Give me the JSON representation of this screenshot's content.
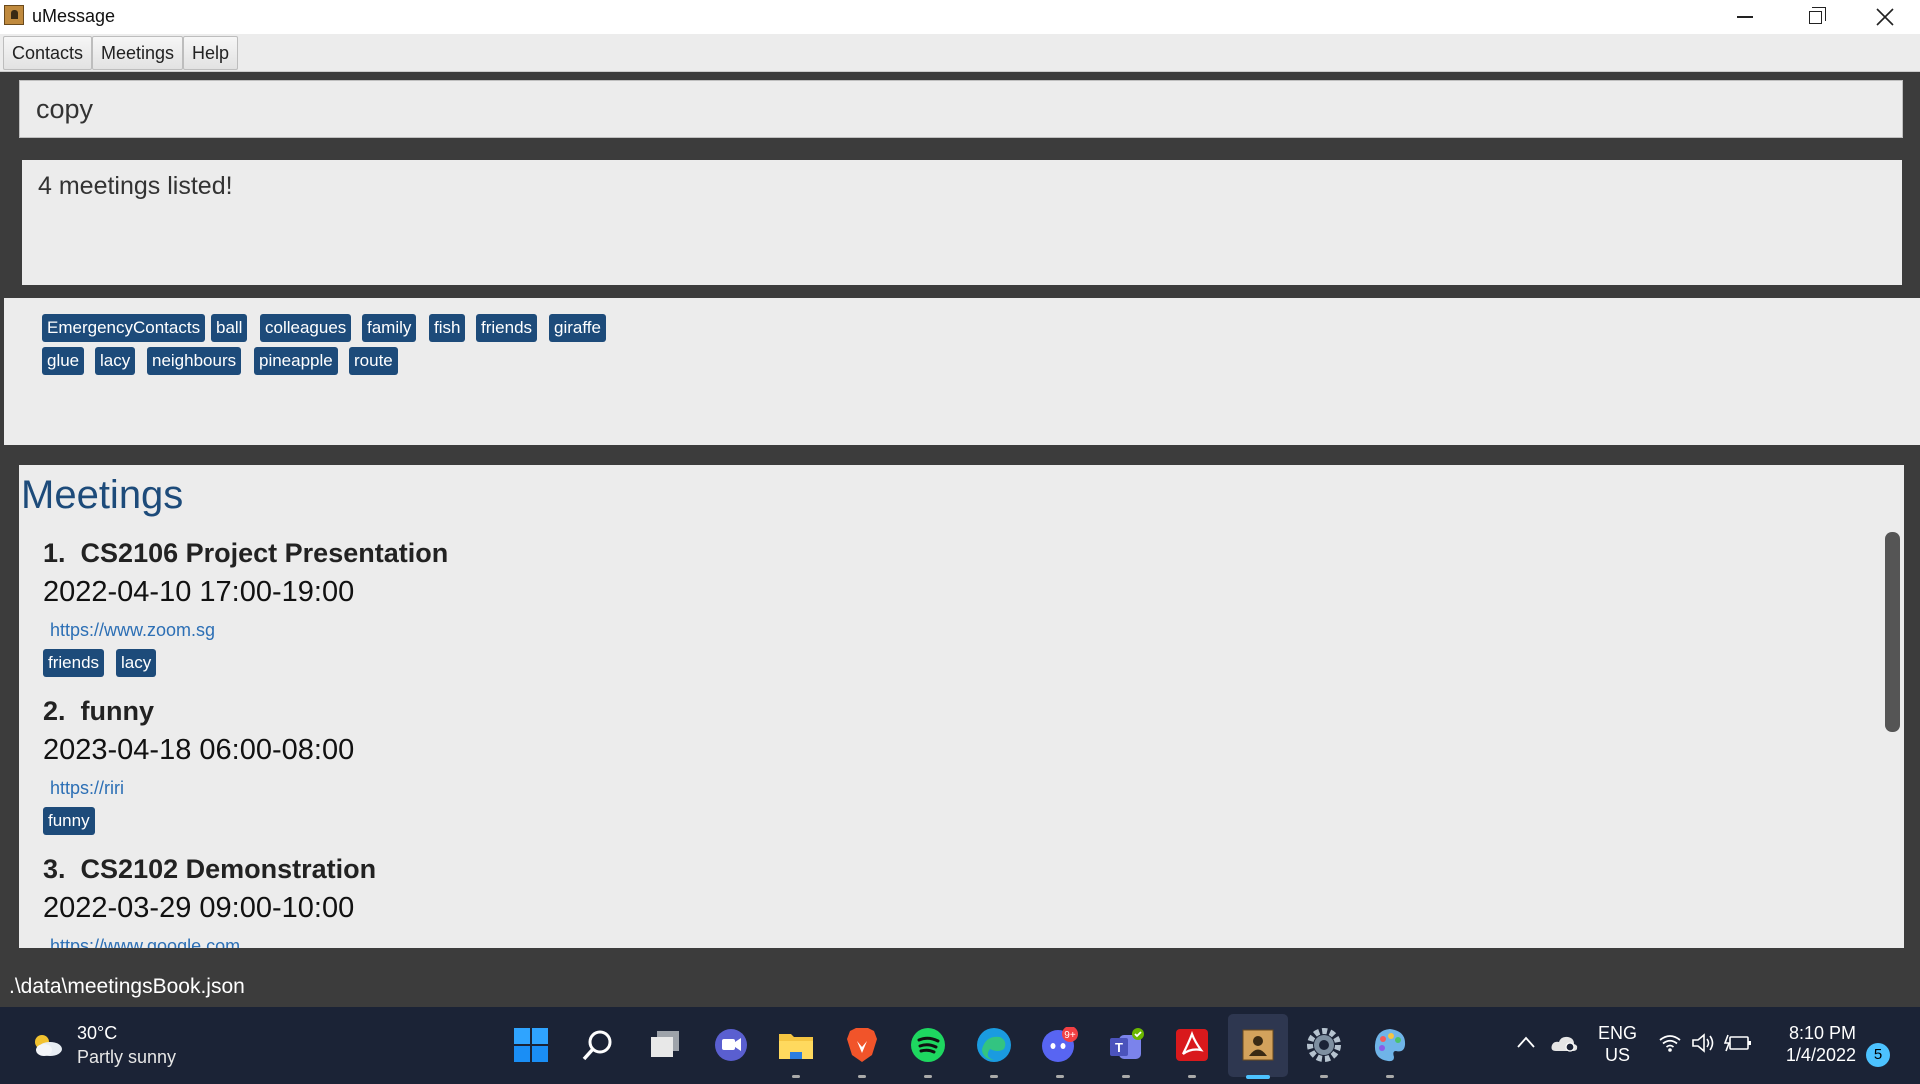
{
  "window": {
    "title": "uMessage",
    "controls": {
      "minimize": "minimize",
      "maximize": "restore",
      "close": "close"
    }
  },
  "menu": [
    {
      "label": "Contacts"
    },
    {
      "label": "Meetings"
    },
    {
      "label": "Help"
    }
  ],
  "command": {
    "value": "copy"
  },
  "result": {
    "text": "4 meetings listed!"
  },
  "tag_panel": {
    "rows": [
      [
        "EmergencyContacts",
        "ball",
        "colleagues",
        "family",
        "fish",
        "friends",
        "giraffe"
      ],
      [
        "glue",
        "lacy",
        "neighbours",
        "pineapple",
        "route"
      ]
    ]
  },
  "meetings_panel": {
    "title": "Meetings",
    "items": [
      {
        "index": "1.",
        "name": "CS2106 Project Presentation",
        "datetime": "2022-04-10 17:00-19:00",
        "link": "https://www.zoom.sg",
        "tags": [
          "friends",
          "lacy"
        ]
      },
      {
        "index": "2.",
        "name": "funny",
        "datetime": "2023-04-18 06:00-08:00",
        "link": "https://riri",
        "tags": [
          "funny"
        ]
      },
      {
        "index": "3.",
        "name": "CS2102 Demonstration",
        "datetime": "2022-03-29 09:00-10:00",
        "link": "https://www.google.com",
        "tags": []
      }
    ]
  },
  "status": {
    "path": ".\\data\\meetingsBook.json"
  },
  "taskbar": {
    "weather": {
      "temp": "30°C",
      "desc": "Partly sunny"
    },
    "apps": [
      "windows-start-icon",
      "search-icon",
      "task-view-icon",
      "chat-icon",
      "file-explorer-icon",
      "brave-browser-icon",
      "spotify-icon",
      "edge-icon",
      "discord-icon",
      "teams-icon",
      "acrobat-icon",
      "umessage-icon",
      "settings-icon",
      "paint-icon"
    ],
    "discord_badge": "9+",
    "language": {
      "line1": "ENG",
      "line2": "US"
    },
    "clock": {
      "time": "8:10 PM",
      "date": "1/4/2022"
    },
    "notifications": "5"
  },
  "colors": {
    "tag_bg": "#1d4b7a",
    "link": "#2c6fb5",
    "panel_dark": "#3c3c3c",
    "panel_light": "#ececec"
  }
}
